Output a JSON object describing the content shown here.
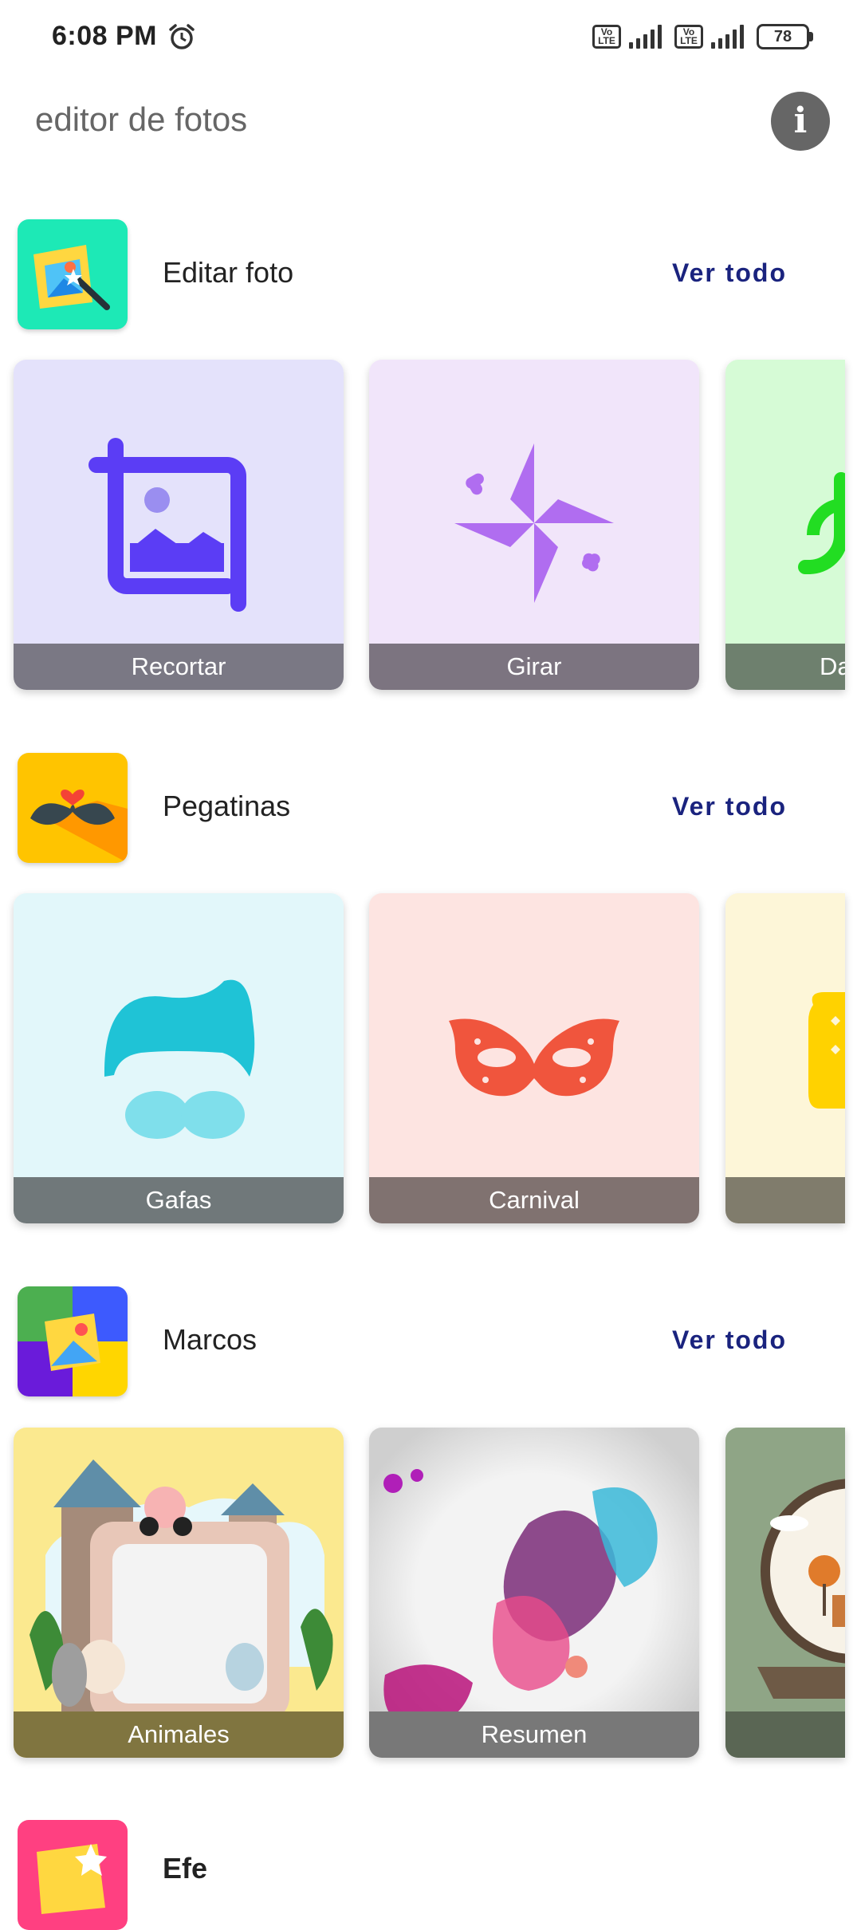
{
  "status": {
    "time": "6:08 PM",
    "sim_badge": "Vo LTE",
    "battery": "78"
  },
  "app": {
    "title": "editor de fotos",
    "info_icon": "info-icon"
  },
  "sections": [
    {
      "title": "Editar foto",
      "view_all": "Ver todo",
      "cards": [
        {
          "label": "Recortar",
          "bg": "#e4e2fb",
          "label_bg": "#7a7884"
        },
        {
          "label": "Girar",
          "bg": "#f1e5fa",
          "label_bg": "#7c7480"
        },
        {
          "label": "Da",
          "bg": "#d6fbd6",
          "label_bg": "#6e806e"
        }
      ]
    },
    {
      "title": "Pegatinas",
      "view_all": "Ver todo",
      "cards": [
        {
          "label": "Gafas",
          "bg": "#e2f7fa",
          "label_bg": "#70787a"
        },
        {
          "label": "Carnival",
          "bg": "#fde4e1",
          "label_bg": "#807270"
        },
        {
          "label": "",
          "bg": "#fdf6d8",
          "label_bg": "#807c6c"
        }
      ]
    },
    {
      "title": "Marcos",
      "view_all": "Ver todo",
      "cards": [
        {
          "label": "Animales",
          "bg": "#fbe98f",
          "label_bg": "#807540"
        },
        {
          "label": "Resumen",
          "bg": "#ebebeb",
          "label_bg": "#787878"
        },
        {
          "label": "",
          "bg": "#8fa586",
          "label_bg": "#5a6654"
        }
      ]
    },
    {
      "title": "Efe",
      "view_all": "",
      "cards": []
    }
  ],
  "colors": {
    "accent_text": "#1a237e",
    "crop_icon": "#5b3df5",
    "rotate_icon": "#b06df0",
    "glasses_icon": "#1fc3d6",
    "mask_icon": "#f0553d"
  }
}
